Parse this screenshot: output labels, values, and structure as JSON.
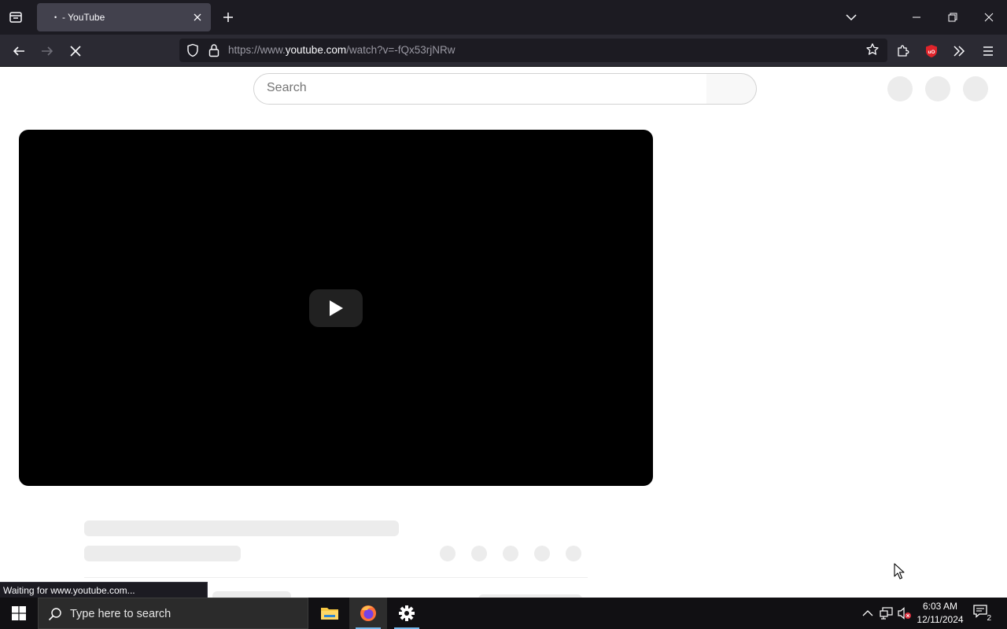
{
  "browser": {
    "tab": {
      "title": "- YouTube",
      "status_dot": "•"
    },
    "urlbar": {
      "prefix": "https://www.",
      "host": "youtube.com",
      "path": "/watch?v=-fQx53rjNRw"
    },
    "status_text": "Waiting for www.youtube.com...",
    "extension_badge": "uO"
  },
  "youtube": {
    "search_placeholder": "Search"
  },
  "taskbar": {
    "search_placeholder": "Type here to search",
    "clock": {
      "time": "6:03 AM",
      "date": "12/11/2024"
    },
    "notification_count": "2"
  },
  "colors": {
    "browser_chrome": "#1c1b22",
    "navbar": "#2b2a33",
    "player": "#000000",
    "skeleton": "#ececec",
    "taskbar": "#111013",
    "ublock_red": "#e0242b",
    "firefox_orange": "#ff7139"
  }
}
